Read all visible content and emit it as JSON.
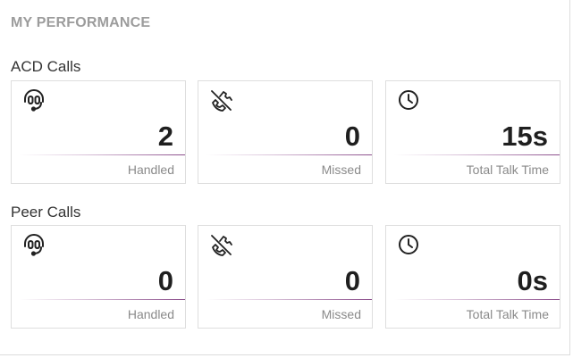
{
  "panel": {
    "title": "MY PERFORMANCE"
  },
  "sections": [
    {
      "label": "ACD Calls",
      "cards": [
        {
          "icon": "headset-icon",
          "value": "2",
          "caption": "Handled"
        },
        {
          "icon": "missed-call-icon",
          "value": "0",
          "caption": "Missed"
        },
        {
          "icon": "clock-icon",
          "value": "15s",
          "caption": "Total Talk Time"
        }
      ]
    },
    {
      "label": "Peer Calls",
      "cards": [
        {
          "icon": "headset-icon",
          "value": "0",
          "caption": "Handled"
        },
        {
          "icon": "missed-call-icon",
          "value": "0",
          "caption": "Missed"
        },
        {
          "icon": "clock-icon",
          "value": "0s",
          "caption": "Total Talk Time"
        }
      ]
    }
  ],
  "colors": {
    "accent": "#8a4c8a",
    "title": "#9c9c9c",
    "caption": "#8a8a8a"
  }
}
